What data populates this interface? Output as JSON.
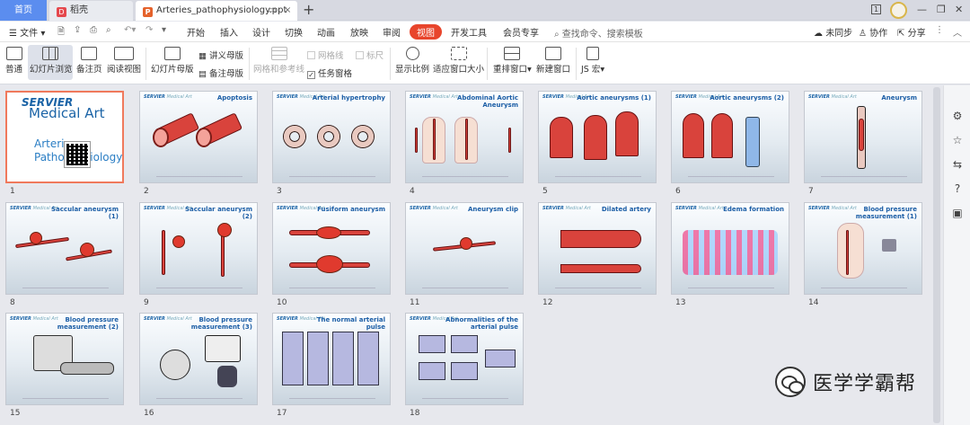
{
  "titlebar": {
    "tabs": [
      {
        "label": "首页"
      },
      {
        "label": "稻壳"
      },
      {
        "label": "Arteries_pathophysiology.ppt"
      }
    ],
    "add_label": "+",
    "window_badge": "1"
  },
  "menubar": {
    "file_label": "文件",
    "items": [
      "开始",
      "插入",
      "设计",
      "切换",
      "动画",
      "放映",
      "审阅",
      "视图",
      "开发工具",
      "会员专享"
    ],
    "search_placeholder": "查找命令、搜索模板",
    "sync_label": "未同步",
    "collab_label": "协作",
    "share_label": "分享"
  },
  "ribbon": {
    "normal": "普通",
    "sorter": "幻灯片浏览",
    "notes_page": "备注页",
    "reading": "阅读视图",
    "slide_master": "幻灯片母版",
    "handout_master": "讲义母版",
    "notes_master": "备注母版",
    "gridlines": "网格线",
    "ruler": "标尺",
    "grid_guides": "网格和参考线",
    "task_pane": "任务窗格",
    "zoom": "显示比例",
    "fit_window": "适应窗口大小",
    "arrange": "重排窗口",
    "new_window": "新建窗口",
    "js_macro": "JS 宏"
  },
  "slides": [
    {
      "num": "1",
      "title": "",
      "logo": "SERVIER",
      "logo_sub": "Medical Art",
      "main_title": "Arteries Pathophysiology"
    },
    {
      "num": "2",
      "title": "Apoptosis"
    },
    {
      "num": "3",
      "title": "Arterial hypertrophy"
    },
    {
      "num": "4",
      "title": "Abdominal Aortic Aneurysm"
    },
    {
      "num": "5",
      "title": "Aortic aneurysms (1)"
    },
    {
      "num": "6",
      "title": "Aortic aneurysms (2)"
    },
    {
      "num": "7",
      "title": "Aneurysm"
    },
    {
      "num": "8",
      "title": "Saccular aneurysm (1)"
    },
    {
      "num": "9",
      "title": "Saccular aneurysm (2)"
    },
    {
      "num": "10",
      "title": "Fusiform aneurysm"
    },
    {
      "num": "11",
      "title": "Aneurysm clip"
    },
    {
      "num": "12",
      "title": "Dilated artery"
    },
    {
      "num": "13",
      "title": "Edema formation"
    },
    {
      "num": "14",
      "title": "Blood pressure measurement (1)"
    },
    {
      "num": "15",
      "title": "Blood pressure measurement (2)"
    },
    {
      "num": "16",
      "title": "Blood pressure measurement (3)"
    },
    {
      "num": "17",
      "title": "The normal arterial pulse"
    },
    {
      "num": "18",
      "title": "Abnormalities of the arterial pulse"
    }
  ],
  "slide_brand": "SERVIER",
  "slide_brand_sub": "Medical Art",
  "watermark": "医学学霸帮",
  "colors": {
    "accent": "#e8452c",
    "home_tab": "#5b8def",
    "artery": "#d9433c",
    "title_blue": "#1c5ea6"
  }
}
